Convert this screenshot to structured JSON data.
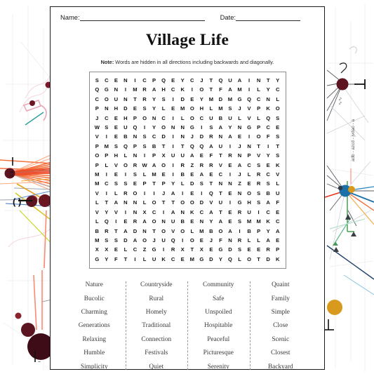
{
  "header": {
    "name_label": "Name:",
    "date_label": "Date:"
  },
  "title": "Village Life",
  "note": {
    "prefix": "Note:",
    "text": " Words are hidden in all directions including backwards and diagonally."
  },
  "puzzle": {
    "rows": 20,
    "cols": 20,
    "letters": [
      [
        "S",
        "C",
        "E",
        "N",
        "I",
        "C",
        "P",
        "Q",
        "E",
        "Y",
        "C",
        "J",
        "T",
        "Q",
        "U",
        "A",
        "I",
        "N",
        "T",
        "Y"
      ],
      [
        "Q",
        "G",
        "N",
        "I",
        "M",
        "R",
        "A",
        "H",
        "C",
        "K",
        "I",
        "O",
        "T",
        "F",
        "A",
        "M",
        "I",
        "L",
        "Y",
        "C"
      ],
      [
        "C",
        "O",
        "U",
        "N",
        "T",
        "R",
        "Y",
        "S",
        "I",
        "D",
        "E",
        "Y",
        "M",
        "D",
        "M",
        "G",
        "Q",
        "C",
        "N",
        "L"
      ],
      [
        "P",
        "N",
        "H",
        "D",
        "E",
        "S",
        "Y",
        "L",
        "E",
        "M",
        "O",
        "H",
        "L",
        "M",
        "S",
        "J",
        "V",
        "P",
        "K",
        "O"
      ],
      [
        "J",
        "C",
        "E",
        "H",
        "P",
        "O",
        "N",
        "C",
        "I",
        "L",
        "O",
        "C",
        "U",
        "B",
        "U",
        "L",
        "V",
        "L",
        "Q",
        "S"
      ],
      [
        "W",
        "S",
        "E",
        "U",
        "Q",
        "I",
        "Y",
        "O",
        "N",
        "N",
        "G",
        "I",
        "S",
        "A",
        "Y",
        "N",
        "G",
        "P",
        "C",
        "E"
      ],
      [
        "V",
        "I",
        "E",
        "B",
        "N",
        "S",
        "C",
        "D",
        "I",
        "N",
        "J",
        "D",
        "R",
        "N",
        "A",
        "E",
        "I",
        "O",
        "F",
        "S"
      ],
      [
        "P",
        "M",
        "S",
        "Q",
        "P",
        "S",
        "B",
        "T",
        "I",
        "T",
        "Q",
        "Q",
        "A",
        "U",
        "I",
        "J",
        "N",
        "T",
        "I",
        "T"
      ],
      [
        "O",
        "P",
        "H",
        "L",
        "N",
        "I",
        "P",
        "X",
        "U",
        "U",
        "A",
        "E",
        "F",
        "T",
        "R",
        "N",
        "P",
        "V",
        "Y",
        "S"
      ],
      [
        "P",
        "L",
        "V",
        "O",
        "R",
        "W",
        "A",
        "O",
        "I",
        "R",
        "Z",
        "R",
        "R",
        "V",
        "E",
        "A",
        "C",
        "S",
        "E",
        "K"
      ],
      [
        "M",
        "I",
        "E",
        "I",
        "S",
        "L",
        "M",
        "E",
        "I",
        "B",
        "E",
        "A",
        "E",
        "C",
        "I",
        "J",
        "L",
        "R",
        "C",
        "V"
      ],
      [
        "M",
        "C",
        "S",
        "S",
        "E",
        "P",
        "T",
        "P",
        "Y",
        "L",
        "D",
        "S",
        "T",
        "N",
        "N",
        "Z",
        "E",
        "R",
        "S",
        "L"
      ],
      [
        "V",
        "I",
        "L",
        "R",
        "O",
        "I",
        "I",
        "J",
        "A",
        "I",
        "E",
        "I",
        "Q",
        "T",
        "E",
        "N",
        "O",
        "S",
        "B",
        "U"
      ],
      [
        "L",
        "T",
        "A",
        "N",
        "N",
        "L",
        "O",
        "T",
        "T",
        "O",
        "O",
        "D",
        "V",
        "U",
        "I",
        "G",
        "H",
        "S",
        "A",
        "F"
      ],
      [
        "V",
        "Y",
        "V",
        "I",
        "N",
        "X",
        "C",
        "I",
        "A",
        "N",
        "K",
        "C",
        "A",
        "T",
        "E",
        "R",
        "U",
        "I",
        "C",
        "E"
      ],
      [
        "L",
        "Q",
        "I",
        "E",
        "R",
        "A",
        "O",
        "N",
        "U",
        "B",
        "E",
        "N",
        "Y",
        "A",
        "E",
        "S",
        "M",
        "M",
        "K",
        "C"
      ],
      [
        "B",
        "R",
        "T",
        "A",
        "D",
        "N",
        "T",
        "O",
        "V",
        "O",
        "L",
        "M",
        "B",
        "O",
        "A",
        "I",
        "B",
        "P",
        "Y",
        "A"
      ],
      [
        "M",
        "S",
        "S",
        "D",
        "A",
        "O",
        "J",
        "U",
        "Q",
        "I",
        "O",
        "E",
        "J",
        "F",
        "N",
        "R",
        "L",
        "L",
        "A",
        "E"
      ],
      [
        "X",
        "X",
        "E",
        "L",
        "C",
        "Z",
        "G",
        "I",
        "R",
        "X",
        "T",
        "X",
        "E",
        "G",
        "D",
        "S",
        "E",
        "E",
        "R",
        "P"
      ],
      [
        "G",
        "Y",
        "F",
        "T",
        "I",
        "L",
        "U",
        "K",
        "C",
        "E",
        "M",
        "G",
        "D",
        "Y",
        "Q",
        "L",
        "O",
        "T",
        "D",
        "K"
      ]
    ]
  },
  "word_list": {
    "columns": [
      [
        "Nature",
        "Bucolic",
        "Charming",
        "Generations",
        "Relaxing",
        "Humble",
        "Simplicity"
      ],
      [
        "Countryside",
        "Rural",
        "Homely",
        "Traditional",
        "Connection",
        "Festivals",
        "Quiet"
      ],
      [
        "Community",
        "Safe",
        "Unspoiled",
        "Hospitable",
        "Peaceful",
        "Picturesque",
        "Serenity"
      ],
      [
        "Quaint",
        "Family",
        "Simple",
        "Close",
        "Scenic",
        "Closest",
        "Backyard"
      ]
    ]
  },
  "colors": {
    "page_border": "#1b1b1b",
    "grid_border": "#8d8d8d",
    "text": "#141414",
    "word_text": "#3a3a3a",
    "art_node_dark_red": "#5c1420",
    "art_node_red": "#e8341c",
    "art_node_blue": "#1d6fa8",
    "art_node_orange": "#d89a1c",
    "art_edge_orange": "#f4652c"
  }
}
